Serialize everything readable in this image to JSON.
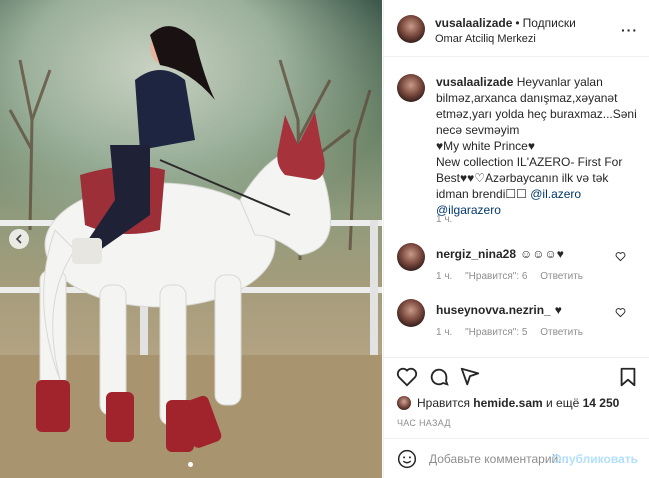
{
  "post": {
    "username": "vusalaalizade",
    "follow_label": "Подписки",
    "location": "Omar Atciliq Merkezi",
    "more_icon": "more-horizontal-icon"
  },
  "caption": {
    "username": "vusalaalizade",
    "text_main": "Heyvanlar yalan bilməz,arxanca danışmaz,xəyanət etməz,yarı yolda heç buraxmaz...Səni necə sevməyim",
    "line2": "♥My white Prince♥",
    "line3": "New collection IL'AZERO- First For Best♥♥♡Azərbaycanın ilk və tək idman brendi☐☐",
    "link1": "@il.azero",
    "link2": "@ilgarazero",
    "time": "1 ч."
  },
  "comments": [
    {
      "username": "nergiz_nina28",
      "text": "☺☺☺♥",
      "time": "1 ч.",
      "likes": "\"Нравится\": 6",
      "reply": "Ответить"
    },
    {
      "username": "huseynovva.nezrin_",
      "text": "♥",
      "time": "1 ч.",
      "likes": "\"Нравится\": 5",
      "reply": "Ответить"
    }
  ],
  "likes": {
    "prefix": "Нравится",
    "user": "hemide.sam",
    "middle": "и ещё",
    "count": "14 250"
  },
  "posted_ago": "ЧАС НАЗАД",
  "comment_box": {
    "placeholder": "Добавьте комментарий...",
    "publish_label": "Опубликовать"
  },
  "colors": {
    "link": "#00376b",
    "muted": "#8e8e8e",
    "publish_disabled": "#b2dffc"
  }
}
